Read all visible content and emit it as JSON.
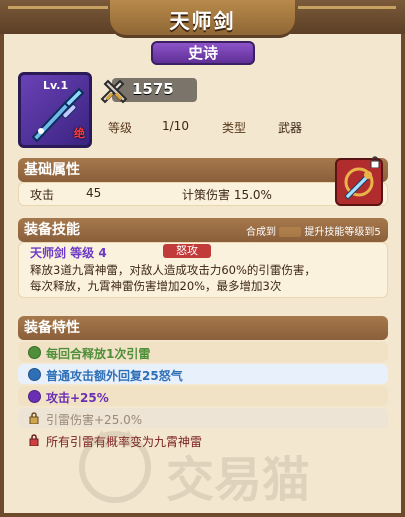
{
  "header": {
    "title": "天师剑",
    "rarity": "史诗"
  },
  "item": {
    "level_label": "Lv.1",
    "jue_badge": "绝",
    "power": "1575",
    "level_key": "等级",
    "level_value": "1/10",
    "type_key": "类型",
    "type_value": "武器"
  },
  "basic_attrs": {
    "title": "基础属性",
    "attack_label": "攻击",
    "attack_value": "45",
    "crit_label": "计策伤害 15.0%"
  },
  "skills": {
    "title": "装备技能",
    "upgrade_hint_prefix": "合成到",
    "upgrade_hint_suffix": "提升技能等级到5",
    "skill_name": "天师剑 等级 4",
    "rage_badge": "怒攻",
    "desc_line1": "释放3道九霄神雷，对敌人造成攻击力60%的引雷伤害，",
    "desc_line2": "每次释放，九霄神雷伤害增加20%，最多增加3次"
  },
  "traits": {
    "title": "装备特性",
    "items": [
      {
        "text": "每回合释放1次引雷",
        "color": "#4f8f3a",
        "locked": false
      },
      {
        "text": "普通攻击额外回复25怒气",
        "color": "#2f6fb6",
        "locked": false
      },
      {
        "text": "攻击+25%",
        "color": "#6a2fb2",
        "locked": false
      },
      {
        "text": "引雷伤害+25.0%",
        "color": "#9b8a74",
        "locked": true
      },
      {
        "text": "所有引雷有概率变为九霄神雷",
        "color": "#7a1f1f",
        "locked": true
      }
    ]
  },
  "watermark_text": "交易猫"
}
